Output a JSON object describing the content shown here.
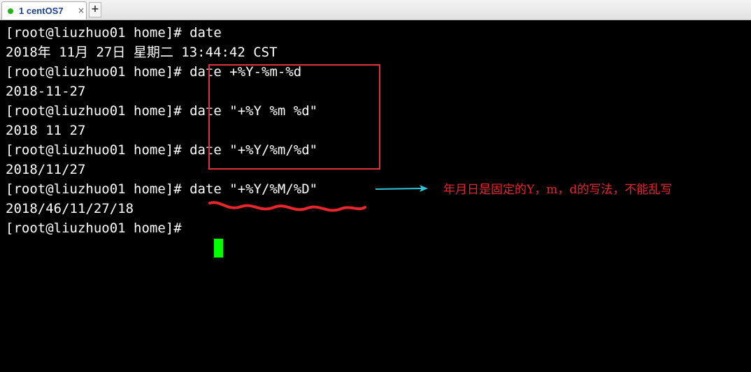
{
  "tab": {
    "label": "1 centOS7",
    "close_glyph": "×",
    "new_glyph": "+"
  },
  "terminal": {
    "lines": [
      "[root@liuzhuo01 home]# date",
      "2018年 11月 27日 星期二 13:44:42 CST",
      "[root@liuzhuo01 home]# date +%Y-%m-%d",
      "2018-11-27",
      "[root@liuzhuo01 home]# date \"+%Y %m %d\"",
      "2018 11 27",
      "[root@liuzhuo01 home]# date \"+%Y/%m/%d\"",
      "2018/11/27",
      "[root@liuzhuo01 home]# date \"+%Y/%M/%D\"",
      "2018/46/11/27/18",
      "[root@liuzhuo01 home]# "
    ],
    "cursor_color": "#00ff00"
  },
  "annotation": {
    "note": "年月日是固定的Y，m，d的写法，不能乱写",
    "color": "#e8262b",
    "arrow_color": "#2fc7d8"
  }
}
